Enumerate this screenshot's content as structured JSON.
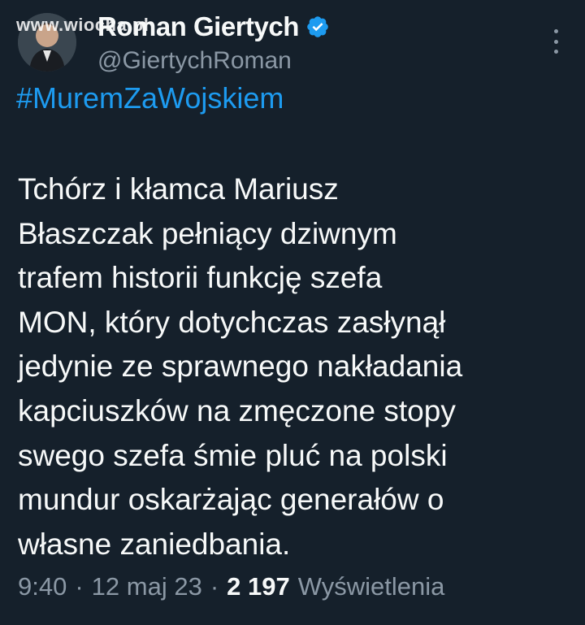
{
  "author": {
    "display_name": "Roman Giertych",
    "handle": "@GiertychRoman",
    "verified": true
  },
  "watermark": "www.wiocha.pl",
  "tweet": {
    "hashtag": "#MuremZaWojskiem",
    "text": "Tchórz i kłamca Mariusz\nBłaszczak pełniący dziwnym\ntrafem historii funkcję szefa\nMON, który dotychczas zasłynął\njedynie ze sprawnego nakładania\nkapciuszków na zmęczone stopy\nswego szefa śmie pluć na polski\nmundur oskarżając generałów o\nwłasne zaniedbania."
  },
  "meta": {
    "time": "9:40",
    "separator": "·",
    "date": "12 maj 23",
    "views_count": "2 197",
    "views_label": "Wyświetlenia"
  },
  "colors": {
    "background": "#15202b",
    "link": "#1d9bf0",
    "secondary_text": "#8b98a5",
    "primary_text": "#f7f9f9"
  },
  "icons": {
    "verified": "verified-badge-icon",
    "more": "more-options-icon"
  }
}
